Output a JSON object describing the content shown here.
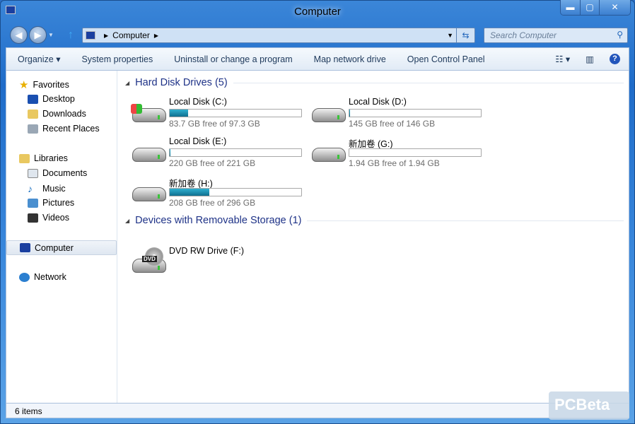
{
  "window": {
    "title": "Computer",
    "minimize": "▬",
    "maximize": "▢",
    "close": "✕"
  },
  "address": {
    "path": "Computer"
  },
  "search": {
    "placeholder": "Search Computer"
  },
  "toolbar": {
    "organize": "Organize ▾",
    "system_properties": "System properties",
    "uninstall": "Uninstall or change a program",
    "map_drive": "Map network drive",
    "control_panel": "Open Control Panel"
  },
  "sidebar": {
    "favorites": "Favorites",
    "desktop": "Desktop",
    "downloads": "Downloads",
    "recent": "Recent Places",
    "libraries": "Libraries",
    "documents": "Documents",
    "music": "Music",
    "pictures": "Pictures",
    "videos": "Videos",
    "computer": "Computer",
    "network": "Network"
  },
  "groups": {
    "hdd": "Hard Disk Drives (5)",
    "removable": "Devices with Removable Storage (1)"
  },
  "drives": [
    {
      "name": "Local Disk (C:)",
      "free": "83.7 GB free of 97.3 GB",
      "used_fraction": 0.14
    },
    {
      "name": "Local Disk (D:)",
      "free": "145 GB free of 146 GB",
      "used_fraction": 0.007
    },
    {
      "name": "Local Disk (E:)",
      "free": "220 GB free of 221 GB",
      "used_fraction": 0.005
    },
    {
      "name": "新加卷 (G:)",
      "free": "1.94 GB free of 1.94 GB",
      "used_fraction": 0
    },
    {
      "name": "新加卷 (H:)",
      "free": "208 GB free of 296 GB",
      "used_fraction": 0.3
    }
  ],
  "dvd": {
    "name": "DVD RW Drive (F:)",
    "label": "DVD"
  },
  "status": {
    "items": "6 items"
  },
  "watermark": "PCBeta"
}
